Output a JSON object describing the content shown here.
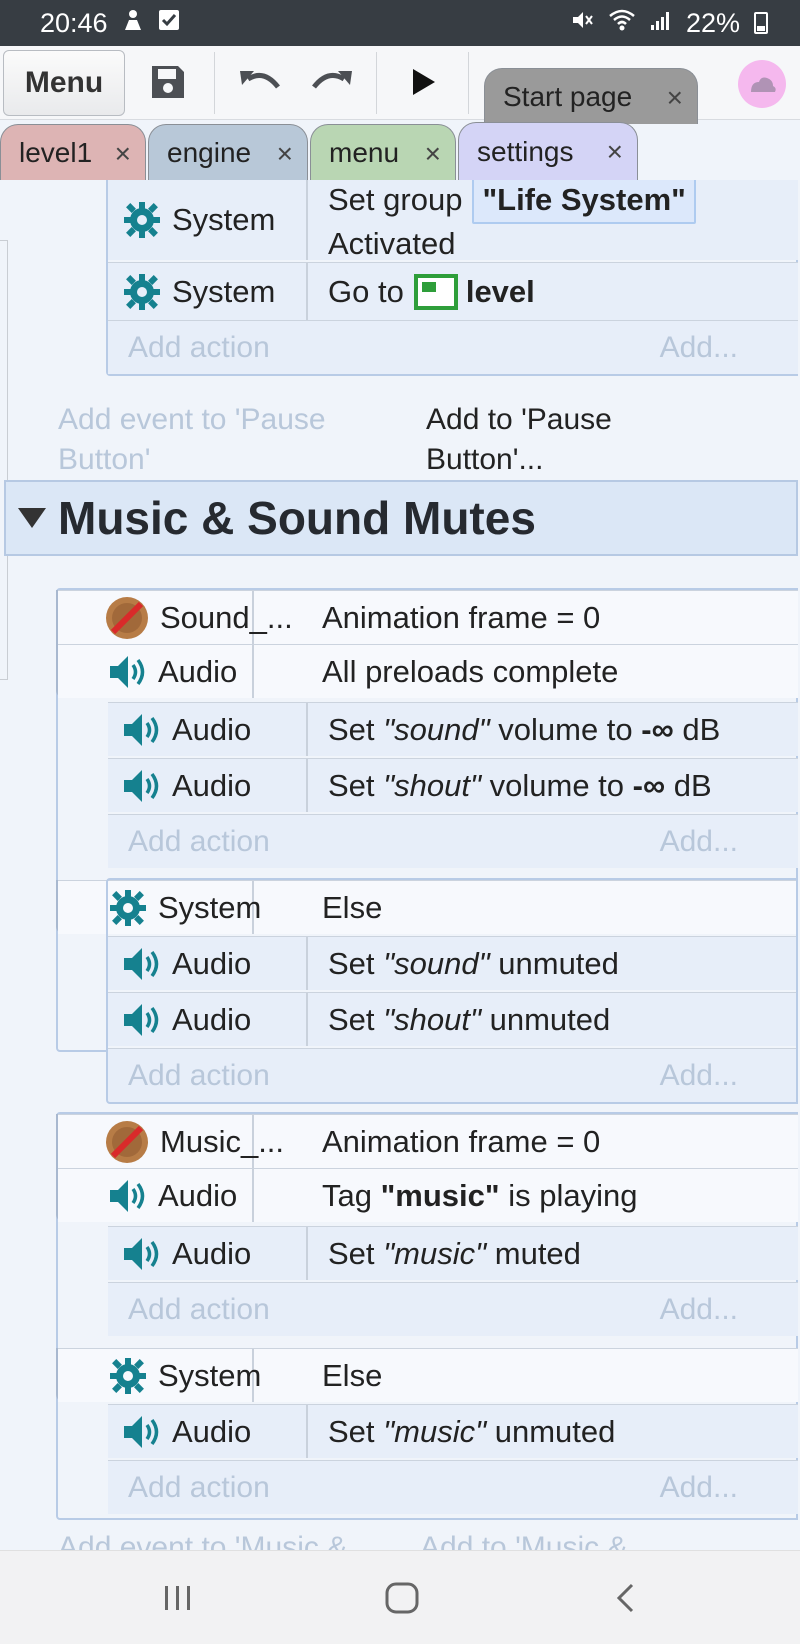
{
  "status": {
    "time": "20:46",
    "battery": "22%"
  },
  "toolbar": {
    "menu_label": "Menu"
  },
  "tabs": {
    "start": "Start page",
    "level1": "level1",
    "engine": "engine",
    "menu": "menu",
    "settings": "settings",
    "close": "×"
  },
  "events_top": {
    "row1_object": "System",
    "row1_text_a": "Set group",
    "row1_badge": "\"Life System\"",
    "row1_text_b": "Activated",
    "row2_object": "System",
    "row2_text": "Go to",
    "row2_target": "level",
    "add_action": "Add action",
    "add_more": "Add...",
    "add_event": "Add event to 'Pause Button'",
    "add_to": "Add to 'Pause Button'..."
  },
  "group": {
    "title": "Music & Sound Mutes"
  },
  "event1": {
    "cond1_object": "Sound_...",
    "cond1_text": "Animation frame = 0",
    "cond2_object": "Audio",
    "cond2_text": "All preloads complete",
    "act1_object": "Audio",
    "act1_pre": "Set",
    "act1_tag": "\"sound\"",
    "act1_mid": "volume to",
    "act1_val": "-∞",
    "act1_unit": "dB",
    "act2_object": "Audio",
    "act2_pre": "Set",
    "act2_tag": "\"shout\"",
    "act2_mid": "volume to",
    "act2_val": "-∞",
    "act2_unit": "dB"
  },
  "event2": {
    "cond1_object": "System",
    "cond1_text": "Else",
    "act1_object": "Audio",
    "act1_pre": "Set",
    "act1_tag": "\"sound\"",
    "act1_post": "unmuted",
    "act2_object": "Audio",
    "act2_pre": "Set",
    "act2_tag": "\"shout\"",
    "act2_post": "unmuted"
  },
  "event3": {
    "cond1_object": "Music_...",
    "cond1_text": "Animation frame = 0",
    "cond2_object": "Audio",
    "cond2_pre": "Tag",
    "cond2_tag": "\"music\"",
    "cond2_post": "is playing",
    "act1_object": "Audio",
    "act1_pre": "Set",
    "act1_tag": "\"music\"",
    "act1_post": "muted"
  },
  "event4": {
    "cond1_object": "System",
    "cond1_text": "Else",
    "act1_object": "Audio",
    "act1_pre": "Set",
    "act1_tag": "\"music\"",
    "act1_post": "unmuted"
  },
  "footer": {
    "add_event": "Add event to 'Music & ...",
    "add_to": "Add to 'Music & ..."
  },
  "colors": {
    "accent": "#15818f",
    "status_bar": "#373d43"
  }
}
